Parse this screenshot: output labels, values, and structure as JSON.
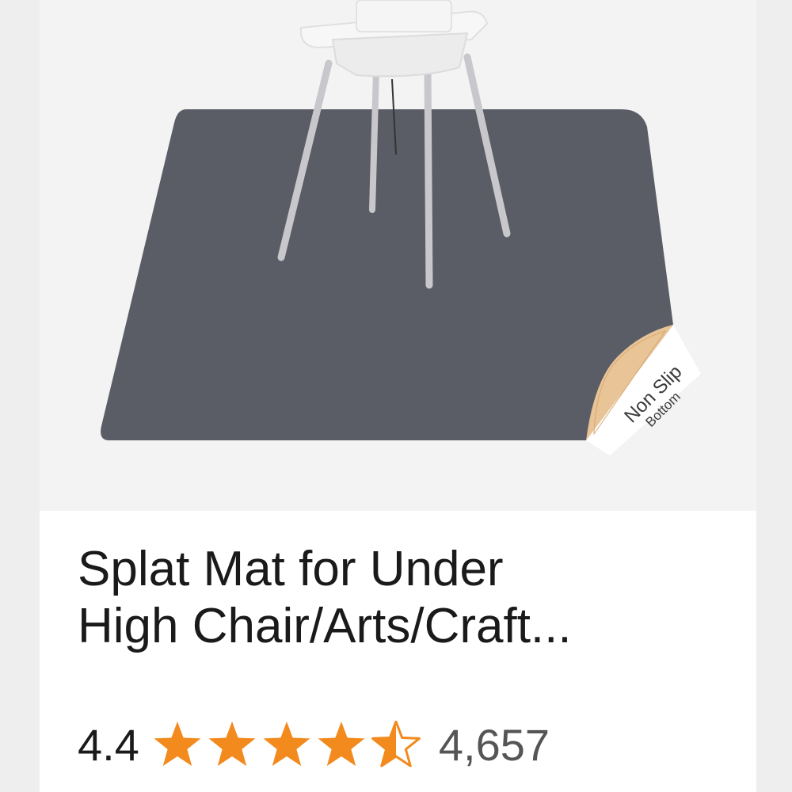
{
  "product": {
    "title": "Splat Mat for Under\nHigh Chair/Arts/Craft...",
    "image_alt": "Gray splat mat under a white high chair",
    "badge_line1": "Non Slip",
    "badge_line2": "Bottom",
    "rating": "4.4",
    "rating_fraction": 0.88,
    "stars_icons": [
      "star-full-icon",
      "star-full-icon",
      "star-full-icon",
      "star-full-icon",
      "star-half-icon"
    ],
    "review_count": "4,657"
  },
  "colors": {
    "mat": "#5b5d66",
    "star": "#f28a1e",
    "badge": "#e8c497"
  }
}
